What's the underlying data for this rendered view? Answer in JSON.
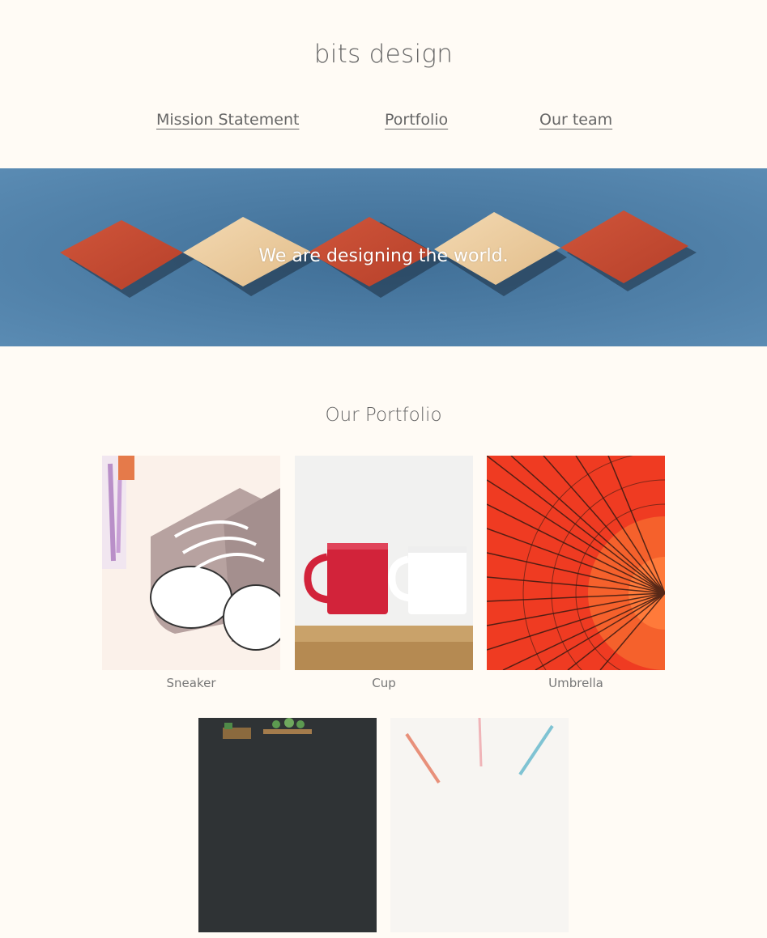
{
  "site": {
    "title": "bits design"
  },
  "nav": {
    "items": [
      {
        "label": "Mission Statement"
      },
      {
        "label": "Portfolio"
      },
      {
        "label": "Our team"
      }
    ]
  },
  "hero": {
    "tagline": "We are designing the world."
  },
  "portfolio": {
    "heading": "Our Portfolio",
    "items": [
      {
        "caption": "Sneaker"
      },
      {
        "caption": "Cup"
      },
      {
        "caption": "Umbrella"
      },
      {
        "caption": ""
      },
      {
        "caption": ""
      }
    ]
  }
}
